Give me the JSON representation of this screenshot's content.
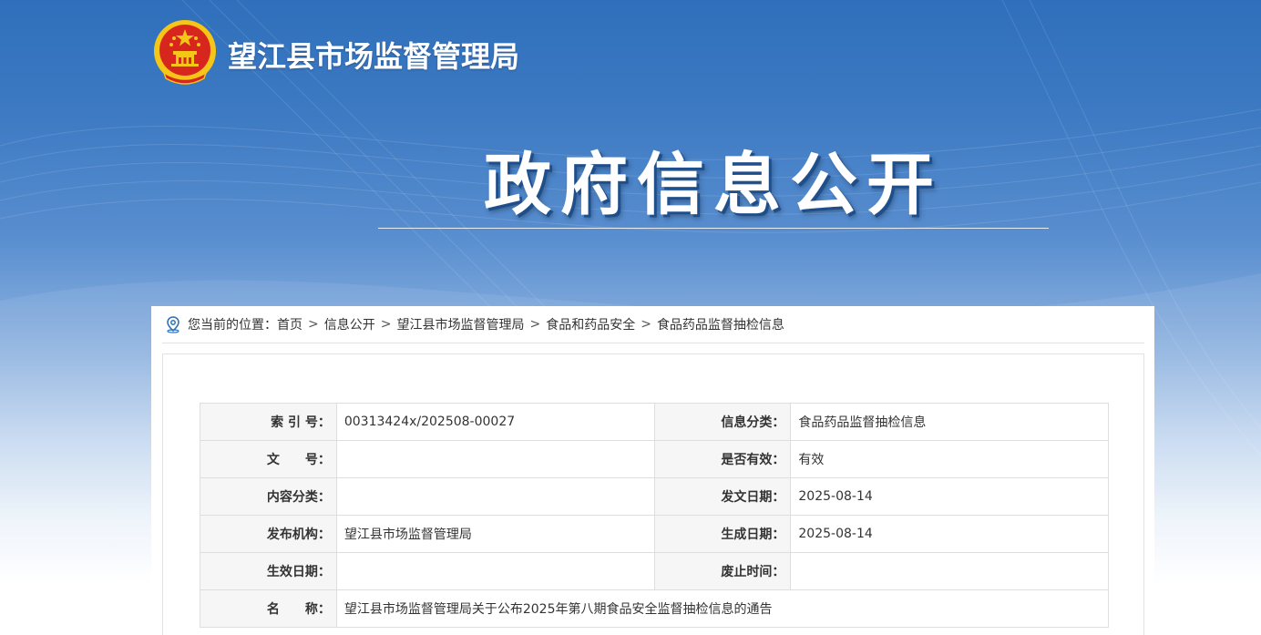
{
  "header": {
    "site_title": "望江县市场监督管理局",
    "hero_title": "政府信息公开",
    "emblem_icon": "national-emblem-icon"
  },
  "breadcrumb": {
    "prefix": "您当前的位置：",
    "items": [
      "首页",
      "信息公开",
      "望江县市场监督管理局",
      "食品和药品安全",
      "食品药品监督抽检信息"
    ],
    "separator": ">"
  },
  "meta": {
    "rows": [
      {
        "k1": "索 引 号：",
        "v1": "00313424x/202508-00027",
        "k2": "信息分类：",
        "v2": "食品药品监督抽检信息"
      },
      {
        "k1": "文　　号：",
        "v1": "",
        "k2": "是否有效：",
        "v2": "有效"
      },
      {
        "k1": "内容分类：",
        "v1": "",
        "k2": "发文日期：",
        "v2": "2025-08-14"
      },
      {
        "k1": "发布机构：",
        "v1": "望江县市场监督管理局",
        "k2": "生成日期：",
        "v2": "2025-08-14"
      },
      {
        "k1": "生效日期：",
        "v1": "",
        "k2": "废止时间：",
        "v2": ""
      }
    ],
    "name_label": "名　　称：",
    "name_value": "望江县市场监督管理局关于公布2025年第八期食品安全监督抽检信息的通告"
  },
  "colors": {
    "banner_top": "#2f6fbb",
    "emblem_red": "#d7261e",
    "emblem_gold": "#f5c518"
  }
}
